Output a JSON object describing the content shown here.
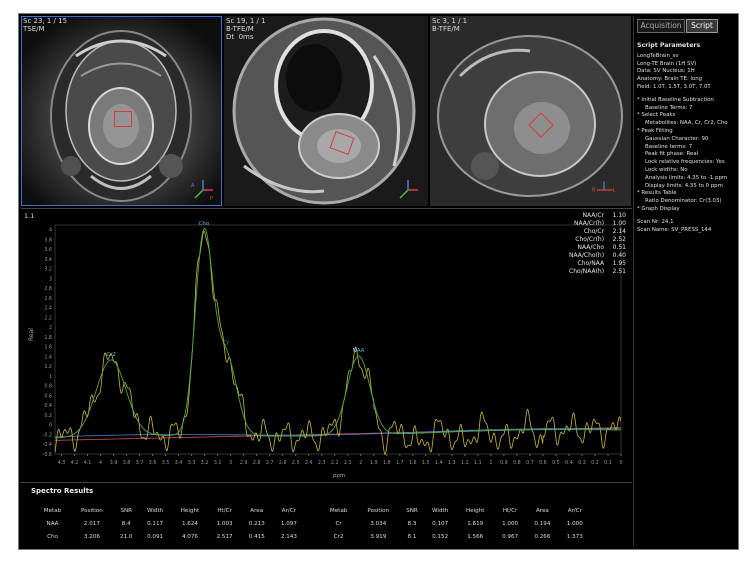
{
  "viewports": [
    {
      "label_line1": "Sc 23, 1 / 15",
      "label_line2": "TSE/M"
    },
    {
      "label_line1": "Sc 19, 1 / 1",
      "label_line2": "B-TFE/M",
      "label_line3": "Dt  0ms"
    },
    {
      "label_line1": "Sc 3, 1 / 1",
      "label_line2": "B-TFE/M"
    }
  ],
  "tabs": {
    "acquisition": "Acquisition",
    "script": "Script"
  },
  "script": {
    "title": "Script Parameters",
    "lines": [
      "LongTeBrain_sv",
      "Long-TE Brain (1H SV)",
      "Data: SV  Nucleus: 1H",
      "Anatomy: Brain  TE: long",
      "Field: 1.0T, 1.5T, 3.0T, 7.0T"
    ],
    "steps": [
      {
        "head": "* Initial Baseline Subtraction",
        "sub": [
          "Baseline Terms: 7"
        ]
      },
      {
        "head": "* Select Peaks",
        "sub": [
          "Metabolites: NAA, Cr, Cr2, Cho"
        ]
      },
      {
        "head": "* Peak Fitting",
        "sub": [
          "Gaussian Character: 90",
          "Baseline terms: 7",
          "Peak fit phase: Real",
          "Lock relative frequencies: Yes",
          "Lock widths: No",
          "Analysis limits: 4.35 to -1 ppm",
          "Display limits: 4.35 to 0 ppm"
        ]
      },
      {
        "head": "* Results Table",
        "sub": [
          "Ratio Denominator: Cr(3.03)"
        ]
      },
      {
        "head": "* Graph Display",
        "sub": []
      }
    ],
    "scan_nr": "Scan Nr: 24,1",
    "scan_name": "Scan Name: SV_PRESS_144"
  },
  "spectrum": {
    "corner_label": "1.1",
    "ylabel": "Real",
    "xlabel": "ppm",
    "x_ticks": [
      "4.3",
      "4.2",
      "4.1",
      "4",
      "3.9",
      "3.8",
      "3.7",
      "3.6",
      "3.5",
      "3.4",
      "3.3",
      "3.2",
      "3.1",
      "3",
      "2.9",
      "2.8",
      "2.7",
      "2.6",
      "2.5",
      "2.4",
      "2.3",
      "2.2",
      "2.1",
      "2",
      "1.9",
      "1.8",
      "1.7",
      "1.6",
      "1.5",
      "1.4",
      "1.3",
      "1.2",
      "1.1",
      "1",
      "0.9",
      "0.8",
      "0.7",
      "0.6",
      "0.5",
      "0.4",
      "0.3",
      "0.2",
      "0.1",
      "0"
    ],
    "y_ticks": [
      "4",
      "3.8",
      "3.6",
      "3.4",
      "3.2",
      "3",
      "2.8",
      "2.6",
      "2.4",
      "2.2",
      "2",
      "1.8",
      "1.6",
      "1.4",
      "1.2",
      "1",
      "0.8",
      "0.6",
      "0.4",
      "0.2",
      "0",
      "-0.2",
      "-0.4",
      "-0.6"
    ],
    "peak_labels": [
      "Cr2",
      "Cho",
      "Cr",
      "NAA"
    ],
    "ratios": [
      {
        "name": "NAA/Cr",
        "value": "1.10"
      },
      {
        "name": "NAA/Cr(h)",
        "value": "1.00"
      },
      {
        "name": "Cho/Cr",
        "value": "2.14"
      },
      {
        "name": "Cho/Cr(h)",
        "value": "2.52"
      },
      {
        "name": "NAA/Cho",
        "value": "0.51"
      },
      {
        "name": "NAA/Cho(h)",
        "value": "0.40"
      },
      {
        "name": "Cho/NAA",
        "value": "1.95"
      },
      {
        "name": "Cho/NAA(h)",
        "value": "2.51"
      }
    ],
    "colors": {
      "data": "#c8b840",
      "fit": "#4aa84a",
      "baseline": "#4a7fd0",
      "residual": "#d05050",
      "label": "#6fb4e0"
    }
  },
  "chart_data": {
    "type": "line",
    "xlabel": "ppm",
    "ylabel": "Real",
    "xlim": [
      4.35,
      0
    ],
    "ylim": [
      -0.6,
      4.1
    ],
    "series": [
      {
        "name": "fit",
        "peaks": [
          {
            "label": "Cr2",
            "ppm": 3.919,
            "height": 1.566,
            "width": 0.152
          },
          {
            "label": "Cho",
            "ppm": 3.206,
            "height": 4.076,
            "width": 0.091
          },
          {
            "label": "Cr",
            "ppm": 3.034,
            "height": 1.619,
            "width": 0.107
          },
          {
            "label": "NAA",
            "ppm": 2.017,
            "height": 1.624,
            "width": 0.117
          }
        ]
      }
    ]
  },
  "results": {
    "title": "Spectro Results",
    "headers": [
      "Metab",
      "Position",
      "SNR",
      "Width",
      "Height",
      "Ht/Cr",
      "Area",
      "Ar/Cr"
    ],
    "left_rows": [
      [
        "NAA",
        "2.017",
        "8.4",
        "0.117",
        "1.624",
        "1.003",
        "0.213",
        "1.097"
      ],
      [
        "Cho",
        "3.206",
        "21.0",
        "0.091",
        "4.076",
        "2.517",
        "0.415",
        "2.143"
      ]
    ],
    "right_rows": [
      [
        "Cr",
        "3.034",
        "8.3",
        "0.107",
        "1.619",
        "1.000",
        "0.194",
        "1.000"
      ],
      [
        "Cr2",
        "3.919",
        "8.1",
        "0.152",
        "1.566",
        "0.967",
        "0.266",
        "1.373"
      ]
    ]
  }
}
